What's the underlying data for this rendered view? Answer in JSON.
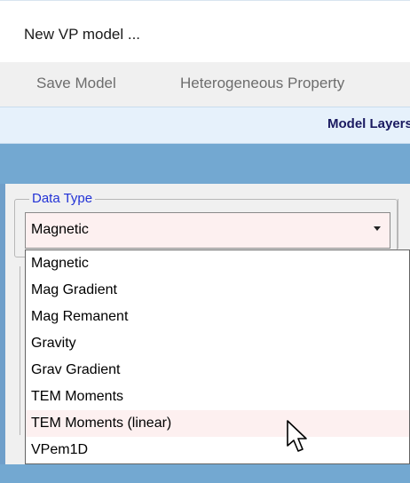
{
  "window": {
    "title": "New VP model ..."
  },
  "menubar": {
    "items": [
      {
        "label": "Save Model"
      },
      {
        "label": "Heterogeneous Property"
      }
    ]
  },
  "tab": {
    "label": "Model Layers"
  },
  "data_type": {
    "group_label": "Data Type",
    "selected_value": "Magnetic",
    "options": [
      "Magnetic",
      "Mag Gradient",
      "Mag Remanent",
      "Gravity",
      "Grav Gradient",
      "TEM Moments",
      "TEM Moments (linear)",
      "VPem1D"
    ],
    "hovered_option": "TEM Moments (linear)"
  },
  "colors": {
    "accent_bar": "#73a8d1",
    "group_label": "#2232d6",
    "tab_header_bg": "#e6f1fb",
    "hover_bg": "#fdf0f0"
  }
}
